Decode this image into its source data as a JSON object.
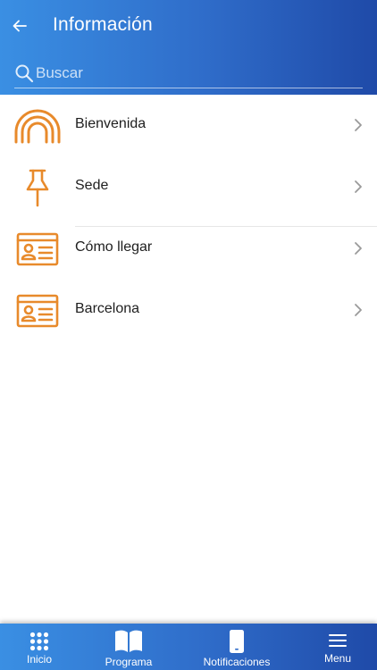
{
  "header": {
    "title": "Información",
    "search_placeholder": "Buscar"
  },
  "colors": {
    "header_gradient_start": "#3a8fe3",
    "header_gradient_end": "#1f4aa8",
    "icon_accent": "#e88a2b"
  },
  "list": {
    "items": [
      {
        "label": "Bienvenida",
        "icon": "rainbow-icon"
      },
      {
        "label": "Sede",
        "icon": "pushpin-icon"
      },
      {
        "label": "Cómo llegar",
        "icon": "id-card-icon"
      },
      {
        "label": "Barcelona",
        "icon": "id-card-icon"
      }
    ]
  },
  "tabbar": {
    "items": [
      {
        "label": "Inicio",
        "icon": "grid-icon"
      },
      {
        "label": "Programa",
        "icon": "book-icon"
      },
      {
        "label": "Notificaciones",
        "icon": "phone-icon"
      },
      {
        "label": "Menu",
        "icon": "hamburger-icon"
      }
    ]
  }
}
